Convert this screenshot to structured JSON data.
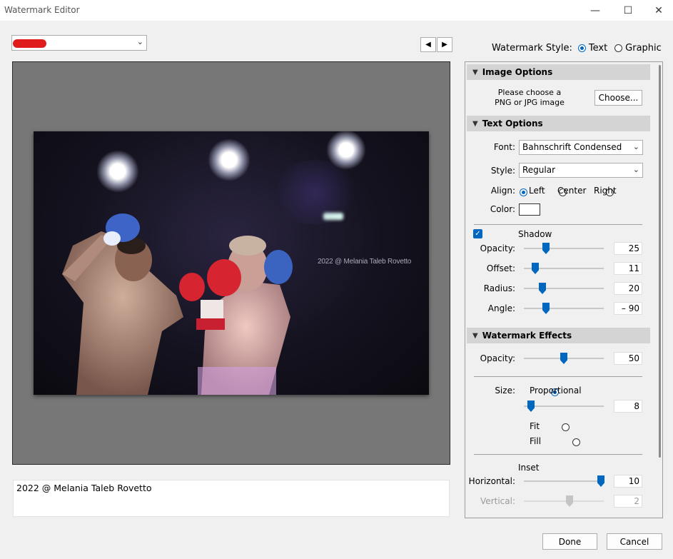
{
  "window": {
    "title": "Watermark Editor",
    "minimize": "—",
    "maximize": "☐",
    "close": "✕"
  },
  "preset": {
    "value": "",
    "chevron": "chevron-down"
  },
  "nav": {
    "prev": "◀",
    "next": "▶"
  },
  "style": {
    "label": "Watermark Style:",
    "text": "Text",
    "graphic": "Graphic",
    "selected": "Text"
  },
  "preview": {
    "watermark_text": "2022 @ Melania Taleb Rovetto"
  },
  "text_entry": {
    "value": "2022 @ Melania Taleb Rovetto"
  },
  "image_options": {
    "header": "Image Options",
    "hint_line1": "Please choose a",
    "hint_line2": "PNG or JPG image",
    "choose": "Choose..."
  },
  "text_options": {
    "header": "Text Options",
    "font_label": "Font:",
    "font_value": "Bahnschrift Condensed",
    "style_label": "Style:",
    "style_value": "Regular",
    "align_label": "Align:",
    "align_left": "Left",
    "align_center": "Center",
    "align_right": "Right",
    "align_selected": "Left",
    "color_label": "Color:",
    "color_value": "#ffffff",
    "shadow_label": "Shadow",
    "shadow_checked": true,
    "opacity_label": "Opacity:",
    "opacity": "25",
    "offset_label": "Offset:",
    "offset": "11",
    "radius_label": "Radius:",
    "radius": "20",
    "angle_label": "Angle:",
    "angle": "– 90"
  },
  "effects": {
    "header": "Watermark Effects",
    "opacity_label": "Opacity:",
    "opacity": "50",
    "size_label": "Size:",
    "proportional": "Proportional",
    "size_value": "8",
    "fit": "Fit",
    "fill": "Fill",
    "size_selected": "Proportional",
    "inset_label": "Inset",
    "horizontal_label": "Horizontal:",
    "horizontal": "10",
    "vertical_label": "Vertical:",
    "vertical": "2"
  },
  "footer": {
    "done": "Done",
    "cancel": "Cancel"
  },
  "colors": {
    "accent": "#0067c0",
    "preview_bg": "#777777",
    "section_header": "#d4d4d4"
  }
}
